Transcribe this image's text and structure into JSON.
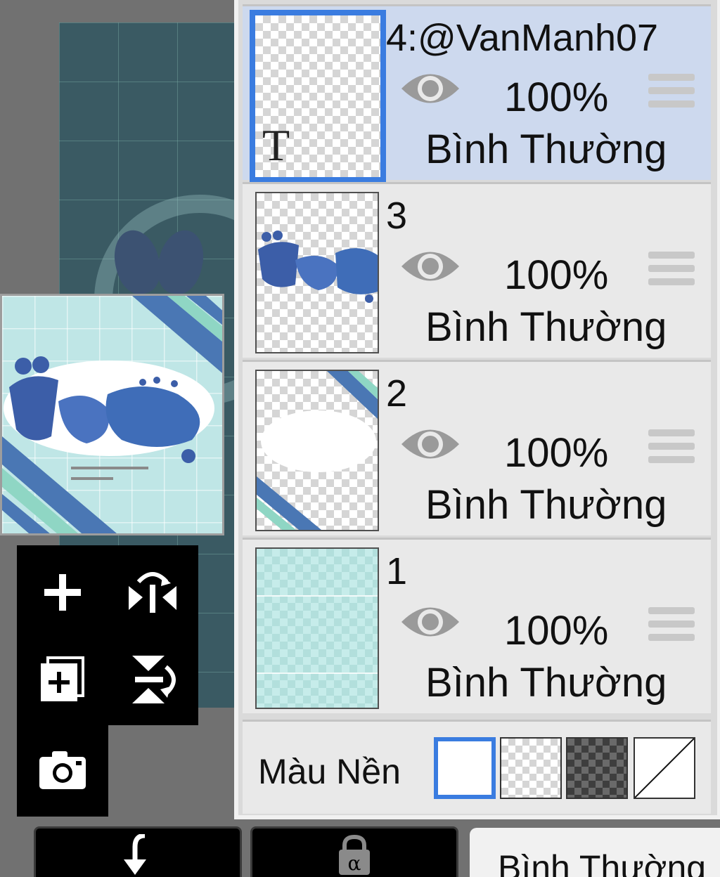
{
  "layers": [
    {
      "name": "4:@VanManh07",
      "opacity": "100%",
      "blend_mode": "Bình Thường",
      "selected": true,
      "type_glyph": "T"
    },
    {
      "name": "3",
      "opacity": "100%",
      "blend_mode": "Bình Thường",
      "selected": false
    },
    {
      "name": "2",
      "opacity": "100%",
      "blend_mode": "Bình Thường",
      "selected": false
    },
    {
      "name": "1",
      "opacity": "100%",
      "blend_mode": "Bình Thường",
      "selected": false
    }
  ],
  "background": {
    "label": "Màu Nền",
    "options": [
      "white-swatch",
      "transparent-swatch",
      "dark-checker-swatch",
      "none-swatch"
    ],
    "selected": "white-swatch"
  },
  "bottom_bar": {
    "blend_mode_value": "Bình Thường"
  },
  "colors": {
    "accent": "#3a7ce0",
    "selected_row": "#cdd9ee",
    "panel": "#e9e9e9",
    "toolbox": "#000000"
  },
  "tools": [
    "add-layer-icon",
    "flip-horizontal-icon",
    "duplicate-layer-icon",
    "flip-vertical-icon",
    "camera-icon"
  ],
  "bottom_icons": [
    "undo-arrow-icon",
    "alpha-lock-icon"
  ]
}
